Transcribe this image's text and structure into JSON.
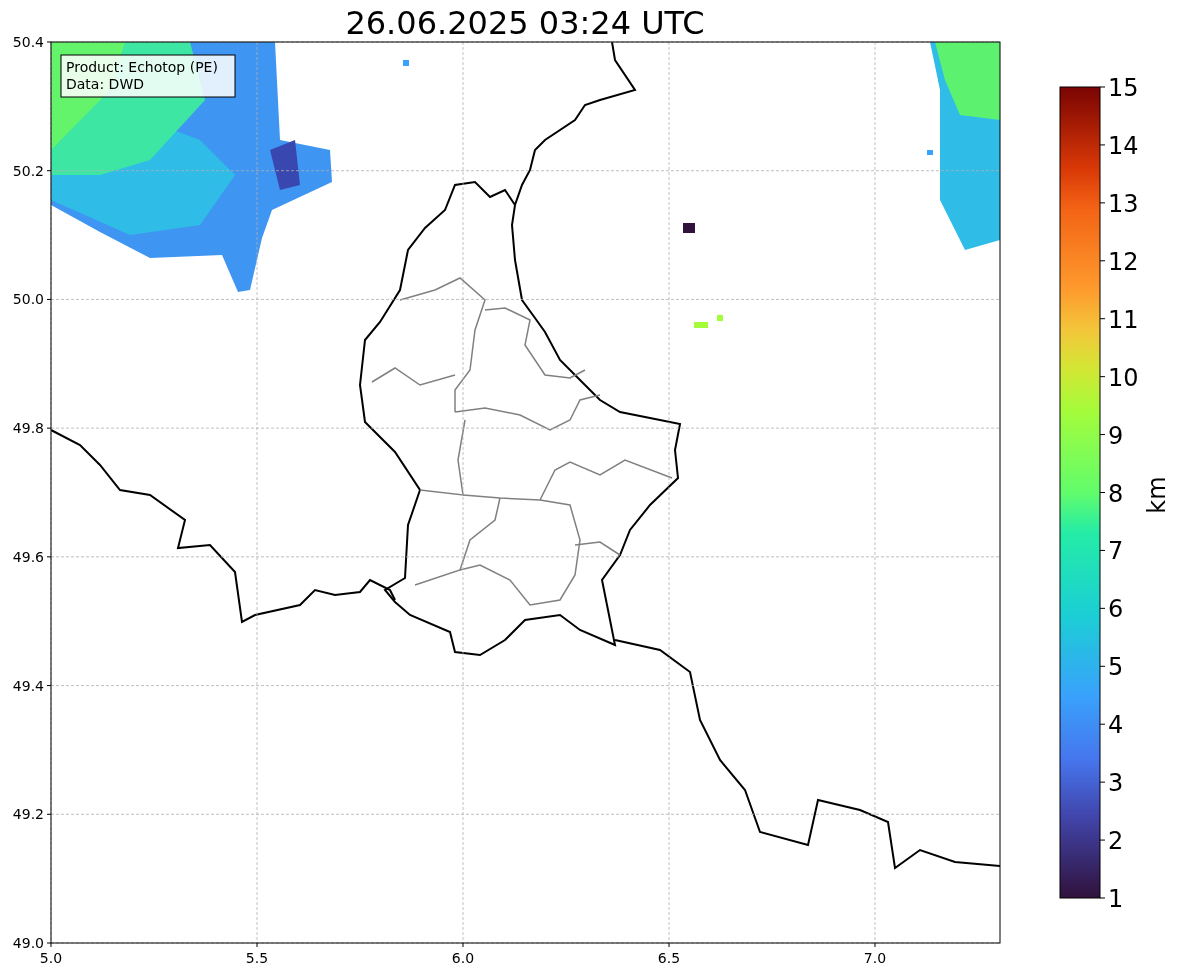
{
  "title": "26.06.2025 03:24 UTC",
  "info_box": [
    "Product: Echotop (PE)",
    "Data: DWD"
  ],
  "x_axis": {
    "ticks": [
      "5.0",
      "5.5",
      "6.0",
      "6.5",
      "7.0"
    ]
  },
  "y_axis": {
    "ticks": [
      "50.4",
      "50.2",
      "50.0",
      "49.8",
      "49.6",
      "49.4",
      "49.2",
      "49.0"
    ]
  },
  "colorbar": {
    "label": "km",
    "ticks": [
      "15",
      "14",
      "13",
      "12",
      "11",
      "10",
      "9",
      "8",
      "7",
      "6",
      "5",
      "4",
      "3",
      "2",
      "1"
    ]
  }
}
